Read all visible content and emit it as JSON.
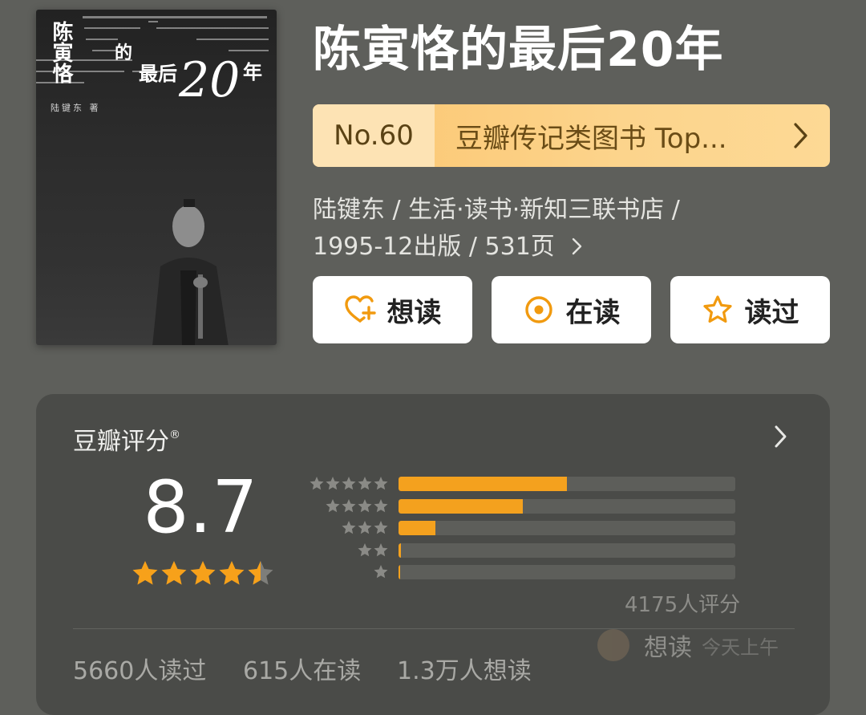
{
  "book": {
    "title": "陈寅恪的最后20年",
    "cover": {
      "title_col": "陈寅恪",
      "title_de": "的",
      "title_zuihou": "最后",
      "title_20": "20",
      "title_nian": "年",
      "author": "陆键东 著"
    }
  },
  "ranking": {
    "number": "No.60",
    "text": "豆瓣传记类图书 Top...",
    "accent": "#fbc56f"
  },
  "meta": {
    "line1": "陆键东 / 生活·读书·新知三联书店 /",
    "line2": "1995-12出版 / 531页"
  },
  "actions": {
    "want": {
      "label": "想读",
      "icon": "heart-plus-icon"
    },
    "reading": {
      "label": "在读",
      "icon": "target-circle-icon"
    },
    "read": {
      "label": "读过",
      "icon": "star-outline-icon"
    }
  },
  "rating": {
    "heading": "豆瓣评分",
    "registered_mark": "®",
    "score": "8.7",
    "stars": 4.5,
    "count_text": "4175人评分",
    "distribution": [
      {
        "stars": 5,
        "fraction": 0.5
      },
      {
        "stars": 4,
        "fraction": 0.37
      },
      {
        "stars": 3,
        "fraction": 0.11
      },
      {
        "stars": 2,
        "fraction": 0.008
      },
      {
        "stars": 1,
        "fraction": 0.004
      }
    ],
    "bar_color": "#f4a11e"
  },
  "stats": {
    "read": "5660人读过",
    "reading": "615人在读",
    "want": "1.3万人想读"
  },
  "toast": {
    "label": "想读",
    "time": "今天上午"
  }
}
